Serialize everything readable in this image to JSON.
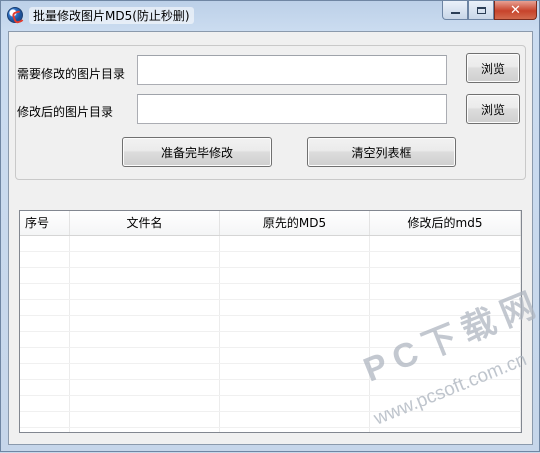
{
  "window": {
    "title": "批量修改图片MD5(防止秒删)",
    "controls": {
      "minimize": "minimize-icon",
      "maximize": "maximize-icon",
      "close": "close-icon"
    }
  },
  "form": {
    "source_dir": {
      "label": "需要修改的图片目录",
      "value": "",
      "browse_label": "浏览"
    },
    "target_dir": {
      "label": "修改后的图片目录",
      "value": "",
      "browse_label": "浏览"
    },
    "ready_button": "准备完毕修改",
    "clear_button": "清空列表框"
  },
  "list": {
    "columns": [
      "序号",
      "文件名",
      "原先的MD5",
      "修改后的md5"
    ],
    "rows": []
  },
  "watermark": {
    "brand": "PC下载网",
    "url": "www.pcsoft.com.cn"
  },
  "colors": {
    "title_bar": "#c6d6ea",
    "close_button": "#c7432b",
    "client_bg": "#f0f0f0"
  }
}
